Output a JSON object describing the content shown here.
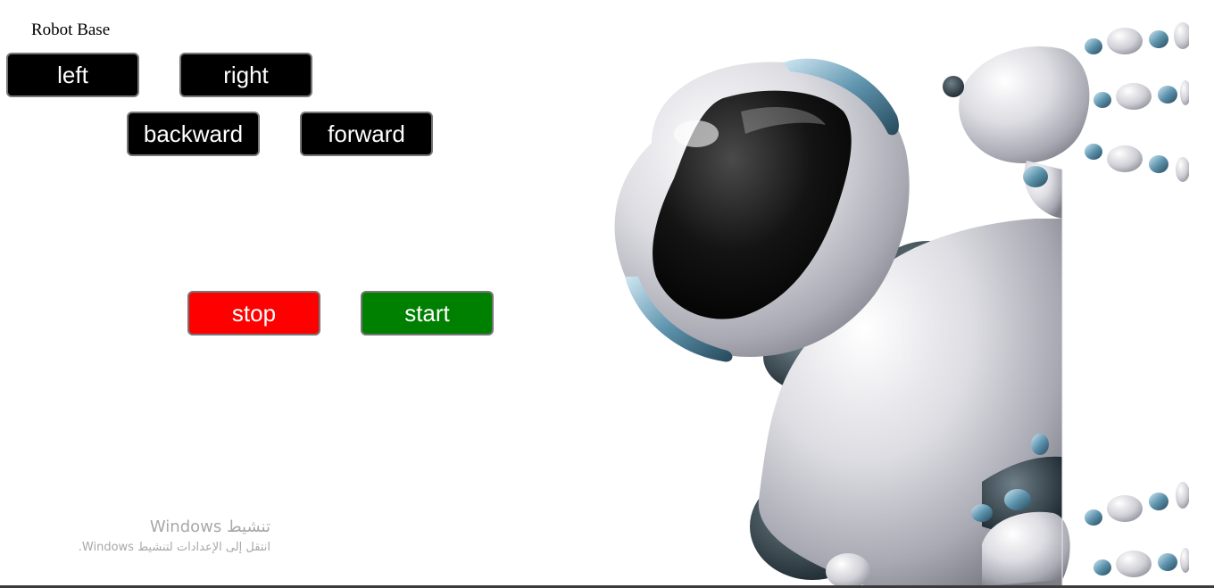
{
  "page": {
    "title": "Robot Base"
  },
  "controls": {
    "left_label": "left",
    "right_label": "right",
    "backward_label": "backward",
    "forward_label": "forward",
    "stop_label": "stop",
    "start_label": "start"
  },
  "colors": {
    "direction_button": "#000000",
    "stop_button": "#ff0000",
    "start_button": "#008000",
    "button_text": "#ffffff"
  },
  "image": {
    "subject": "robot-illustration"
  },
  "watermark": {
    "line1": "تنشيط Windows",
    "line2": "انتقل إلى الإعدادات لتنشيط Windows."
  }
}
